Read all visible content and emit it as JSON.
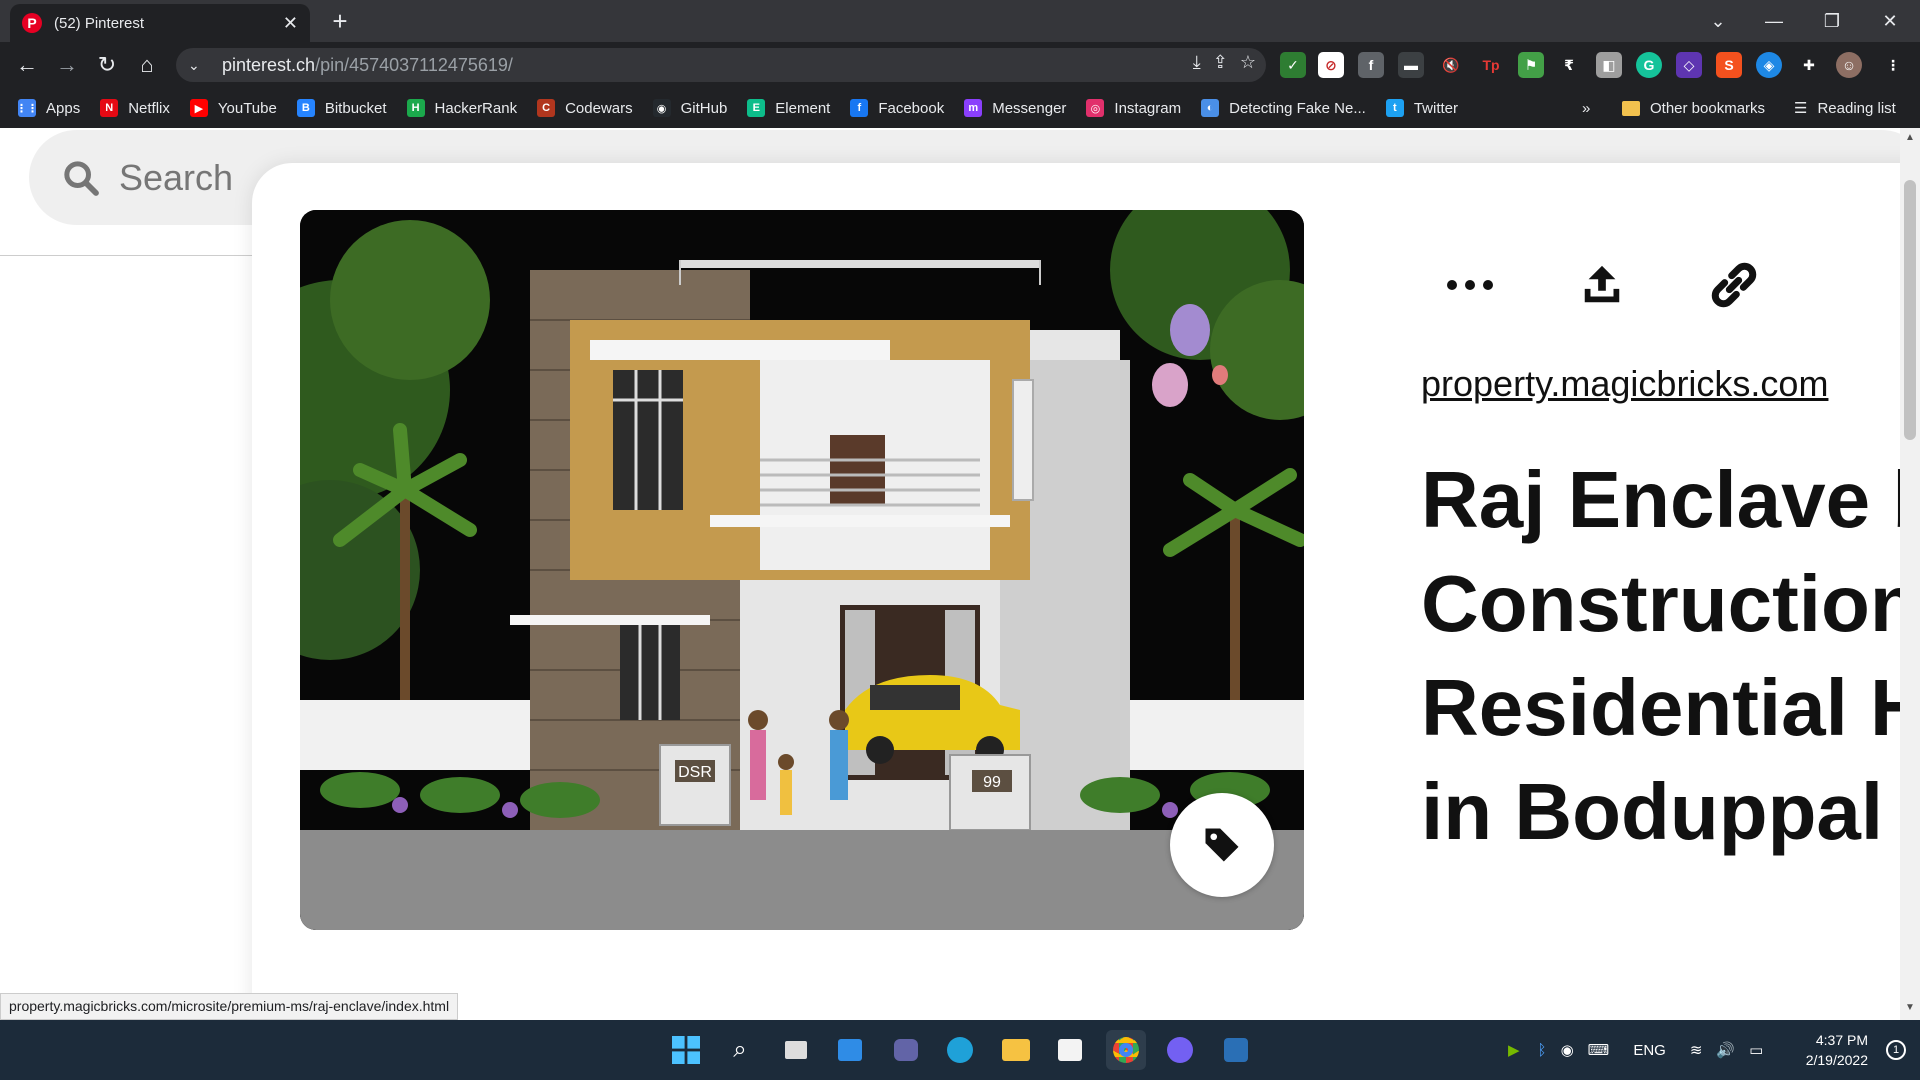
{
  "browser": {
    "tab": {
      "title": "(52) Pinterest",
      "favicon": "P"
    },
    "url": {
      "host": "pinterest.ch",
      "path": "/pin/4574037112475619/"
    },
    "bookmarks": [
      {
        "label": "Apps",
        "icon": "apps-grid-icon",
        "color": "#4285f4",
        "glyph": "⋮⋮"
      },
      {
        "label": "Netflix",
        "icon": "netflix-icon",
        "color": "#e50914",
        "glyph": "N"
      },
      {
        "label": "YouTube",
        "icon": "youtube-icon",
        "color": "#ff0000",
        "glyph": "▶"
      },
      {
        "label": "Bitbucket",
        "icon": "bitbucket-icon",
        "color": "#2684ff",
        "glyph": "B"
      },
      {
        "label": "HackerRank",
        "icon": "hackerrank-icon",
        "color": "#1ba94c",
        "glyph": "H"
      },
      {
        "label": "Codewars",
        "icon": "codewars-icon",
        "color": "#b1361e",
        "glyph": "C"
      },
      {
        "label": "GitHub",
        "icon": "github-icon",
        "color": "#24292e",
        "glyph": "◉"
      },
      {
        "label": "Element",
        "icon": "element-icon",
        "color": "#0dbd8b",
        "glyph": "E"
      },
      {
        "label": "Facebook",
        "icon": "facebook-icon",
        "color": "#1877f2",
        "glyph": "f"
      },
      {
        "label": "Messenger",
        "icon": "messenger-icon",
        "color": "#8a3ffc",
        "glyph": "m"
      },
      {
        "label": "Instagram",
        "icon": "instagram-icon",
        "color": "#e1306c",
        "glyph": "◎"
      },
      {
        "label": "Detecting Fake Ne...",
        "icon": "page-icon",
        "color": "#4a8fe7",
        "glyph": "◐"
      },
      {
        "label": "Twitter",
        "icon": "twitter-icon",
        "color": "#1da1f2",
        "glyph": "t"
      }
    ],
    "bookmarks_overflow": "»",
    "other_bookmarks": "Other bookmarks",
    "reading_list": "Reading list"
  },
  "page": {
    "search_placeholder": "Search",
    "source_link": "property.magicbricks.com",
    "title": "Raj Enclave by DSR Constructions Residential House in Boduppal Gandhi Nagar Hyderabad",
    "title_lines": [
      "Raj Enclave b",
      "Construction",
      "Residential H",
      "in Boduppal G"
    ],
    "image_signs": {
      "left_gate": "DSR",
      "right_gate": "99"
    }
  },
  "status_url": "property.magicbricks.com/microsite/premium-ms/raj-enclave/index.html",
  "taskbar": {
    "language": "ENG",
    "time": "4:37 PM",
    "date": "2/19/2022",
    "notification_count": "1"
  },
  "colors": {
    "pinterest_red": "#e60023",
    "chrome_dark": "#202124",
    "taskbar_bg": "#1c2b3a"
  }
}
